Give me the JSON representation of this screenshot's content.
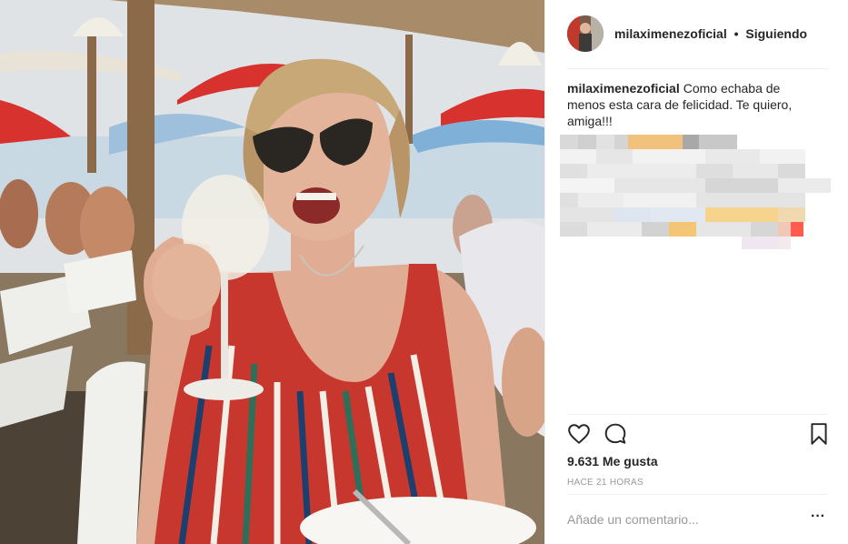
{
  "post": {
    "photo": {
      "alt_icon": "beach-restaurant-photo"
    },
    "header": {
      "username": "milaximenezoficial",
      "separator": "•",
      "follow_state": "Siguiendo"
    },
    "caption": {
      "username": "milaximenezoficial",
      "text": "Como echaba de menos esta cara de felicidad. Te quiero, amiga!!!"
    },
    "actions": {
      "like_icon": "heart-icon",
      "comment_icon": "comment-icon",
      "save_icon": "bookmark-icon"
    },
    "likes": "9.631 Me gusta",
    "timestamp": "HACE 21 HORAS",
    "comment": {
      "placeholder": "Añade un comentario...",
      "more": "···"
    }
  },
  "colors": {
    "text": "#262626",
    "muted": "#999999",
    "divider": "#efefef",
    "umbrella_red": "#d8322f",
    "dress_red": "#c8372d"
  }
}
